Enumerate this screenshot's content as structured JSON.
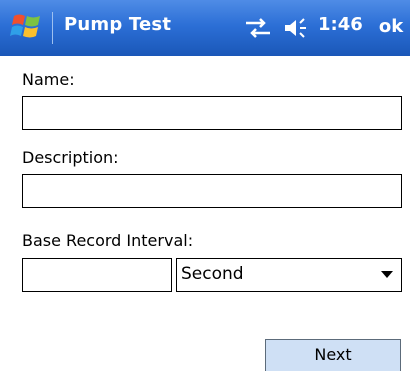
{
  "titlebar": {
    "title": "Pump Test",
    "time": "1:46",
    "ok_label": "ok",
    "start_icon": "windows-flag-icon",
    "connection_icon": "connectivity-icon",
    "volume_icon": "speaker-icon",
    "colors": {
      "bar_top": "#4f8ce6",
      "bar_bottom": "#1a57b8",
      "text": "#ffffff"
    }
  },
  "form": {
    "name_label": "Name:",
    "name_value": "",
    "description_label": "Description:",
    "description_value": "",
    "interval_label": "Base Record Interval:",
    "interval_value": "",
    "interval_unit": "Second"
  },
  "actions": {
    "next_label": "Next",
    "colors": {
      "next_bg": "#cfe0f5"
    }
  }
}
